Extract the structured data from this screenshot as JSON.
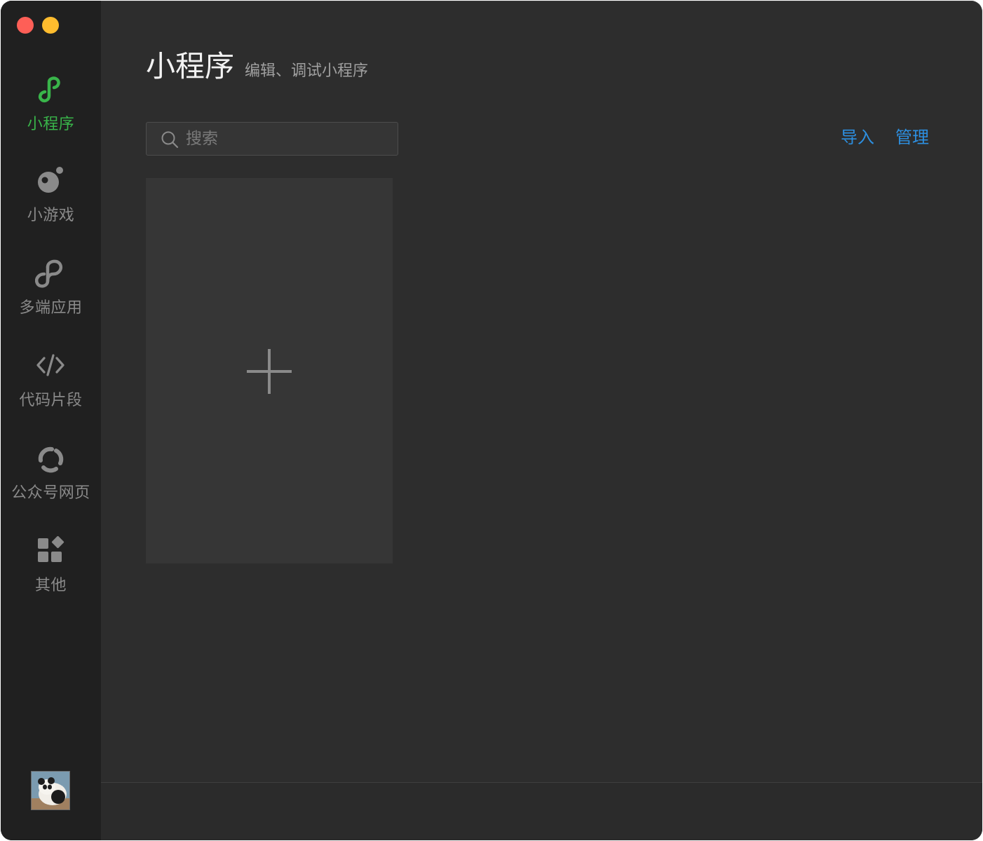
{
  "window": {
    "controls": [
      "close",
      "minimize"
    ]
  },
  "sidebar": {
    "items": [
      {
        "label": "小程序",
        "icon": "miniprogram-icon",
        "active": true
      },
      {
        "label": "小游戏",
        "icon": "minigame-icon",
        "active": false
      },
      {
        "label": "多端应用",
        "icon": "multiplatform-icon",
        "active": false
      },
      {
        "label": "代码片段",
        "icon": "code-icon",
        "active": false
      },
      {
        "label": "公众号网页",
        "icon": "official-account-icon",
        "active": false
      },
      {
        "label": "其他",
        "icon": "apps-grid-icon",
        "active": false
      }
    ],
    "avatar": "user-avatar"
  },
  "main": {
    "title": "小程序",
    "subtitle": "编辑、调试小程序",
    "search": {
      "placeholder": "搜索",
      "value": ""
    },
    "actions": {
      "import_label": "导入",
      "manage_label": "管理"
    },
    "new_project_card": {
      "icon": "plus-icon"
    }
  },
  "colors": {
    "accent_green": "#39b54a",
    "link_blue": "#2d8fe0",
    "sidebar_bg": "#202020",
    "main_bg": "#2d2d2d",
    "card_bg": "#363636",
    "close_red": "#fe5f57",
    "minimize_yellow": "#febc2e"
  }
}
